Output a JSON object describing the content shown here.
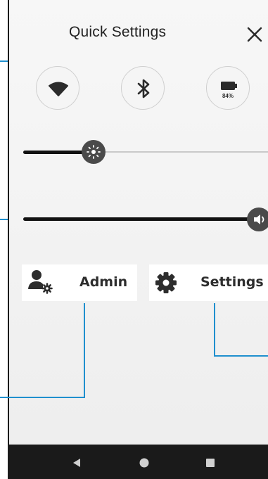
{
  "header": {
    "title": "Quick Settings",
    "close_icon": "close-icon"
  },
  "quick_toggles": [
    {
      "name": "wifi",
      "icon": "wifi-icon"
    },
    {
      "name": "bluetooth",
      "icon": "bluetooth-icon"
    },
    {
      "name": "battery",
      "icon": "battery-icon",
      "label": "84%"
    }
  ],
  "sliders": {
    "brightness": {
      "icon": "brightness-icon",
      "level": 0.28
    },
    "volume": {
      "icon": "volume-icon",
      "level": 1.0
    }
  },
  "tiles": {
    "admin": {
      "label": "Admin",
      "icon": "admin-user-gear-icon"
    },
    "settings": {
      "label": "Settings",
      "icon": "gear-icon"
    }
  },
  "navigation_bar": {
    "back_icon": "back-triangle-icon",
    "home_icon": "home-circle-icon",
    "recents_icon": "recents-square-icon"
  },
  "colors": {
    "callout": "#1f8fce",
    "navbar": "#1a1a1a",
    "slider_thumb": "#4a4a4a",
    "slider_fill": "#111111"
  }
}
